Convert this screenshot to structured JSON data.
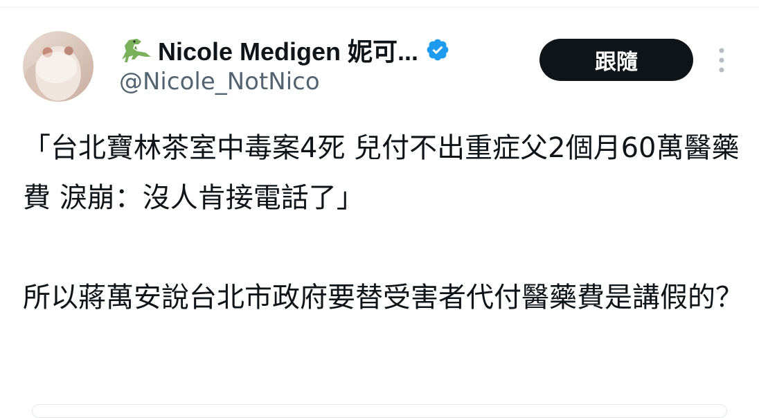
{
  "tweet": {
    "author": {
      "display_name": "Nicole Medigen 妮可...",
      "handle": "@Nicole_NotNico",
      "name_emoji_icon": "t-rex-emoji",
      "verified_icon": "verified-badge-icon",
      "verified_color": "#1d9bf0"
    },
    "follow_label": "跟隨",
    "more_icon": "more-vertical-icon",
    "text": {
      "paragraph1": "「台北寶林茶室中毒案4死 兒付不出重症父2個月60萬醫藥費 淚崩：沒人肯接電話了」",
      "paragraph2": "所以蔣萬安說台北市政府要替受害者代付醫藥費是講假的？"
    }
  }
}
